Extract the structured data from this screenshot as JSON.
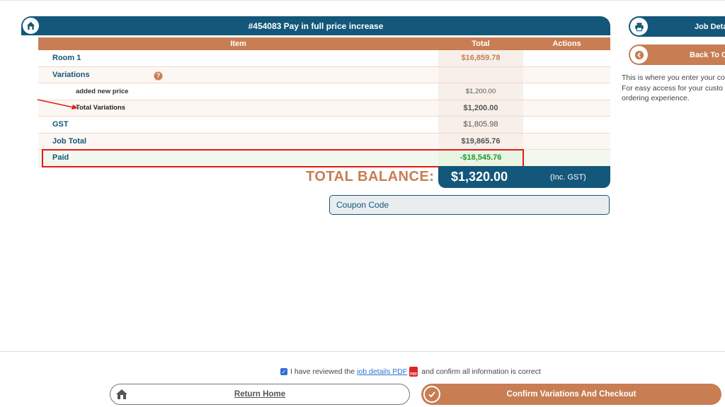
{
  "card": {
    "title": "#454083 Pay in full price increase"
  },
  "table": {
    "headers": {
      "item": "Item",
      "total": "Total",
      "actions": "Actions"
    },
    "rows": [
      {
        "item": "Room 1",
        "total": "$16,859.78"
      },
      {
        "item": "Variations",
        "total": ""
      },
      {
        "item": "added new price",
        "total": "$1,200.00"
      },
      {
        "item": "Total Variations",
        "total": "$1,200.00"
      },
      {
        "item": "GST",
        "total": "$1,805.98"
      },
      {
        "item": "Job Total",
        "total": "$19,865.76"
      },
      {
        "item": "Paid",
        "total": "-$18,545.76"
      }
    ],
    "help_glyph": "?"
  },
  "balance": {
    "label": "TOTAL BALANCE:",
    "amount": "$1,320.00",
    "tax_note": "(Inc. GST)"
  },
  "coupon": {
    "placeholder": "Coupon Code"
  },
  "sidebar": {
    "job_details_label": "Job Deta",
    "back_label": "Back To C",
    "info_lines": [
      "This is where you enter your co",
      "For easy access for your custo",
      "ordering experience."
    ]
  },
  "footer": {
    "confirm_prefix": "I have reviewed the",
    "pdf_link": "job details PDF",
    "pdf_icon_text": "PDF",
    "confirm_suffix": "and confirm all information is correct",
    "return_home": "Return Home",
    "confirm_checkout": "Confirm Variations And Checkout"
  },
  "colors": {
    "primary": "#13577a",
    "accent": "#c87d53",
    "paid_green": "#1f9a2c",
    "highlight_red": "#e11b1b"
  }
}
